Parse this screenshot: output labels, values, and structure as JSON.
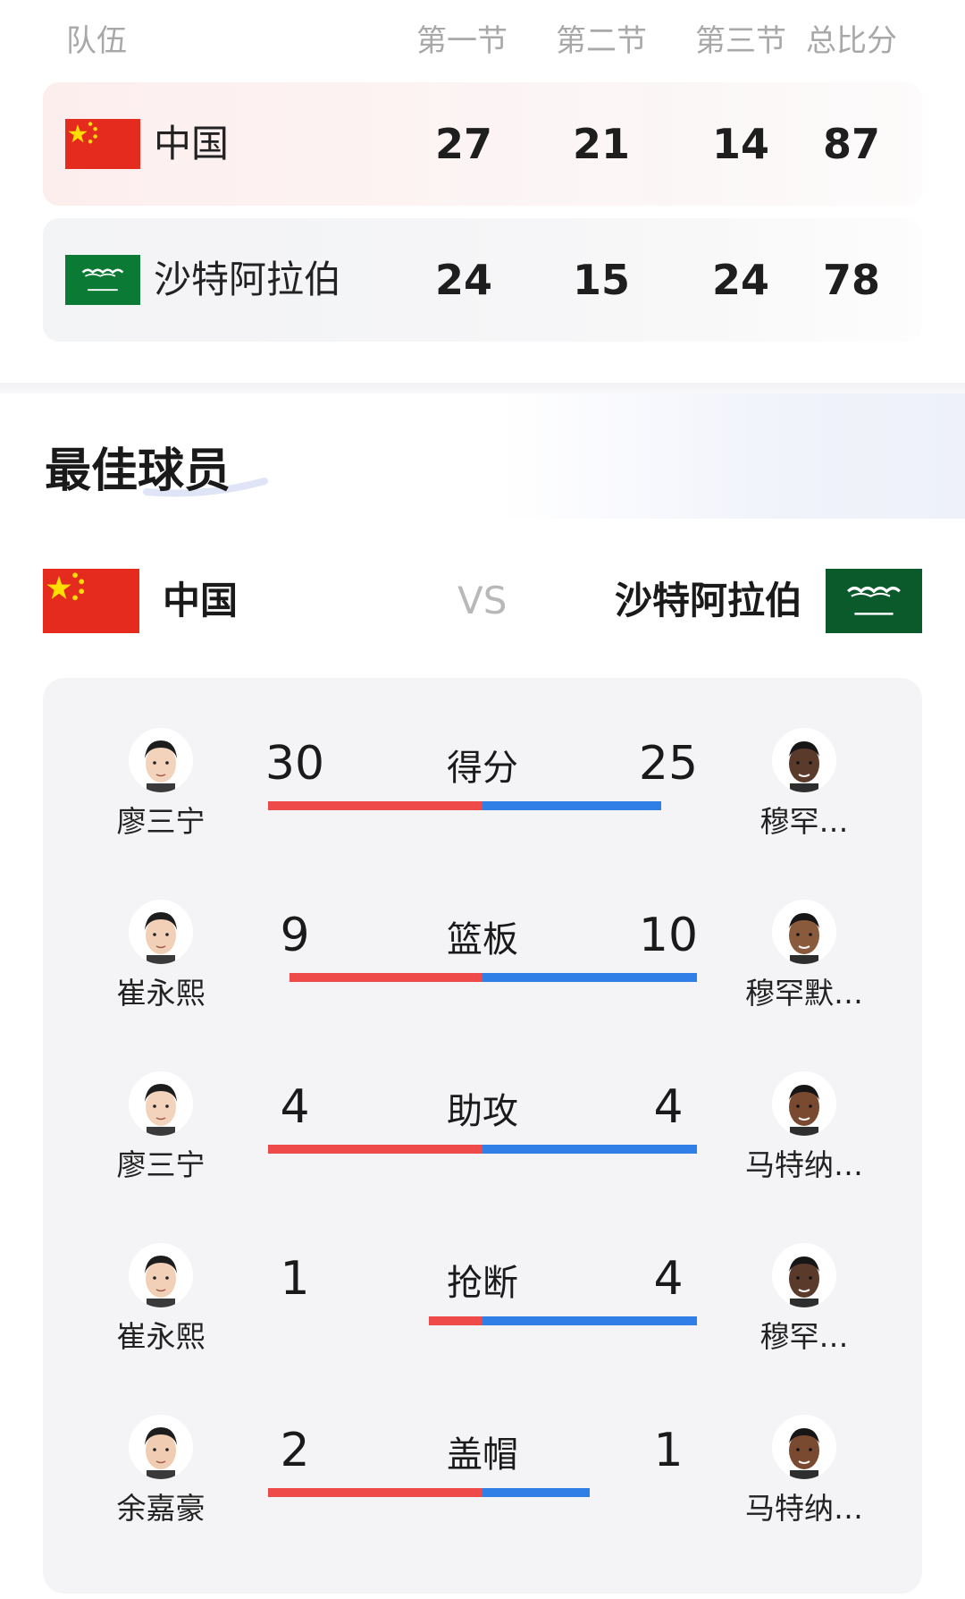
{
  "score_table": {
    "headers": {
      "team": "队伍",
      "q1": "第一节",
      "q2": "第二节",
      "q3": "第三节",
      "total": "总比分"
    },
    "rows": [
      {
        "team": "中国",
        "q1": "27",
        "q2": "21",
        "q3": "14",
        "total": "87",
        "flag": "china-flag-icon"
      },
      {
        "team": "沙特阿拉伯",
        "q1": "24",
        "q2": "15",
        "q3": "24",
        "total": "78",
        "flag": "saudi-flag-icon"
      }
    ]
  },
  "best_players": {
    "title": "最佳球员",
    "left_team": "中国",
    "vs": "VS",
    "right_team": "沙特阿拉伯",
    "colors": {
      "left_bar": "#ee4a4a",
      "right_bar": "#2f7fe6"
    },
    "stats": [
      {
        "label": "得分",
        "left_value": 30,
        "right_value": 25,
        "left_player": "廖三宁",
        "right_player": "穆罕…"
      },
      {
        "label": "篮板",
        "left_value": 9,
        "right_value": 10,
        "left_player": "崔永熙",
        "right_player": "穆罕默…"
      },
      {
        "label": "助攻",
        "left_value": 4,
        "right_value": 4,
        "left_player": "廖三宁",
        "right_player": "马特纳…"
      },
      {
        "label": "抢断",
        "left_value": 1,
        "right_value": 4,
        "left_player": "崔永熙",
        "right_player": "穆罕…"
      },
      {
        "label": "盖帽",
        "left_value": 2,
        "right_value": 1,
        "left_player": "余嘉豪",
        "right_player": "马特纳…"
      }
    ]
  }
}
